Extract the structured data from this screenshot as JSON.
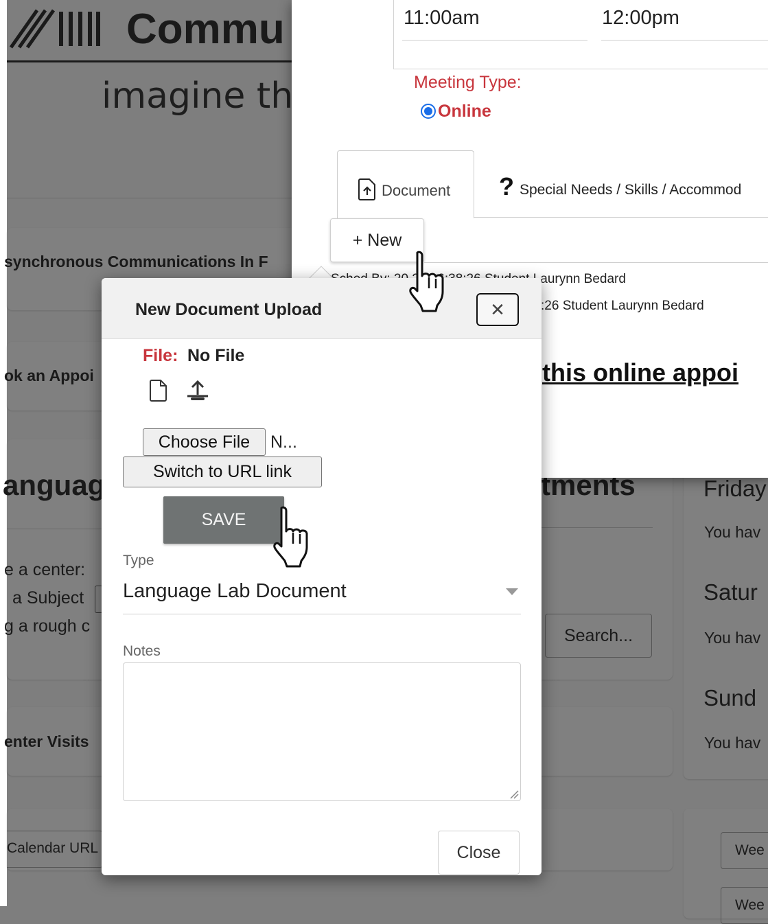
{
  "background": {
    "logo_text": "Commu",
    "tagline": "imagine th",
    "card_async": "synchronous Communications In F",
    "card_book": "ok an Appoi",
    "heading_language": "anguag",
    "heading_appointments": "tments",
    "choose_center": "e a center:",
    "subject": "a Subject",
    "rough": "g a rough c",
    "search_button": "Search...",
    "center_visits": "enter Visits",
    "calendar_url": "Calendar URL",
    "day_friday": "Friday",
    "day_saturday": "Satur",
    "day_sunday": "Sund",
    "you_have_1": "You hav",
    "you_have_2": "You hav",
    "you_have_3": "You hav",
    "week_button_1": "Wee",
    "week_button_2": "Wee"
  },
  "appointment_panel": {
    "start_time": "11:00am",
    "end_time": "12:00pm",
    "meeting_type_label": "Meeting Type:",
    "meeting_online_label": "Online",
    "tab_document": "Document",
    "tab_special_needs_icon": "?",
    "tab_special_needs": "Special Needs / Skills / Accommod",
    "new_button": "+ New",
    "history_line_1": "Sched By: 20   22 16:38:26 Student Laurynn Bedard",
    "history_line_2": ":26 Student Laurynn Bedard",
    "online_appointment_text": "this online appoi"
  },
  "modal": {
    "title": "New Document Upload",
    "close_x": "✕",
    "file_label": "File:",
    "file_value": "No File",
    "choose_file": "Choose File",
    "file_chosen": "N...",
    "switch_url": "Switch to URL link",
    "save": "SAVE",
    "type_label": "Type",
    "type_value": "Language Lab Document",
    "notes_label": "Notes",
    "notes_value": "",
    "close_button": "Close"
  },
  "colors": {
    "accent_red": "#c8363d",
    "save_bg": "#6f7373",
    "overlay": "#7e7e7e"
  }
}
